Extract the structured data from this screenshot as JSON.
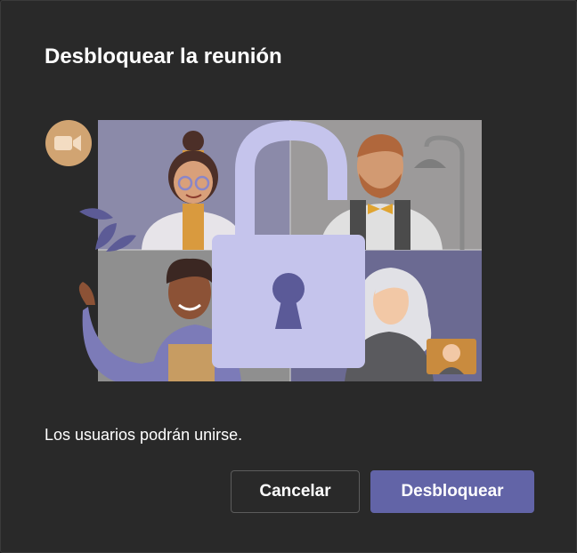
{
  "dialog": {
    "title": "Desbloquear la reunión",
    "message": "Los usuarios podrán unirse.",
    "cancel_label": "Cancelar",
    "confirm_label": "Desbloquear"
  },
  "colors": {
    "dialog_bg": "#292929",
    "primary": "#6264a7",
    "lock_body": "#c5c4ec",
    "lock_keyhole": "#5b5a98",
    "camera_badge": "#d1a472"
  },
  "icons": [
    "video-camera-icon",
    "unlocked-padlock-icon"
  ]
}
